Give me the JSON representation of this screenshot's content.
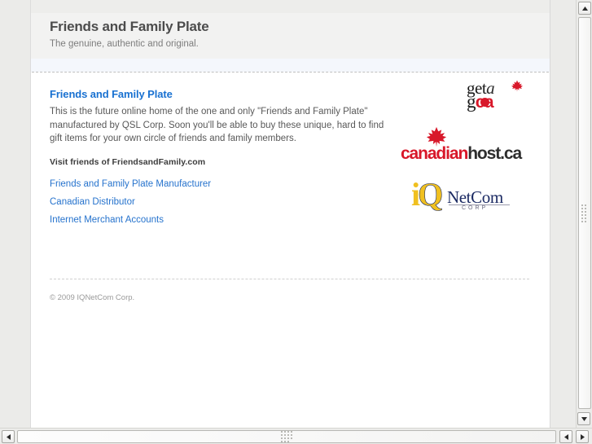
{
  "header": {
    "site_title": "Friends and Family Plate",
    "tagline": "The genuine, authentic and original."
  },
  "main": {
    "page_title": "Friends and Family Plate",
    "intro": "This is the future online home of the one and only \"Friends and Family Plate\" manufactured by QSL Corp. Soon you'll be able to buy these unique, hard to find gift items for your own circle of friends and family members.",
    "visit_heading": "Visit friends of FriendsandFamily.com",
    "links": [
      {
        "label": "Friends and Family Plate Manufacturer"
      },
      {
        "label": "Canadian Distributor"
      },
      {
        "label": "Internet Merchant Accounts"
      }
    ]
  },
  "logos": {
    "getaca": {
      "name": "get-a-dot-ca-logo",
      "line1_get": "get",
      "line1_a": "a",
      "line2_g": "g",
      "line2_ca": "ca"
    },
    "canadianhost": {
      "name": "canadianhost-ca-logo",
      "part_red": "canadian",
      "part_dark": "host.ca"
    },
    "iqnetcom": {
      "name": "iqnetcom-corp-logo",
      "mark_i": "i",
      "mark_q": "Q",
      "word": "NetCom",
      "sub": "CORP"
    }
  },
  "footer": {
    "copyright": "© 2009 IQNetCom Corp."
  },
  "colors": {
    "link": "#2673cd",
    "heading": "#1971d1",
    "red": "#d8182a",
    "yellow": "#f0c020",
    "navy": "#1b2a63",
    "header_bg": "#f2f2f1",
    "blue_band": "#f4f7fc",
    "page_bg": "#ffffff",
    "chrome_bg": "#ebebe9"
  },
  "scrollbars": {
    "vertical_up_icon": "triangle-up",
    "vertical_down_icon": "triangle-down",
    "horizontal_left_icon": "triangle-left",
    "horizontal_right_icon": "triangle-right"
  }
}
